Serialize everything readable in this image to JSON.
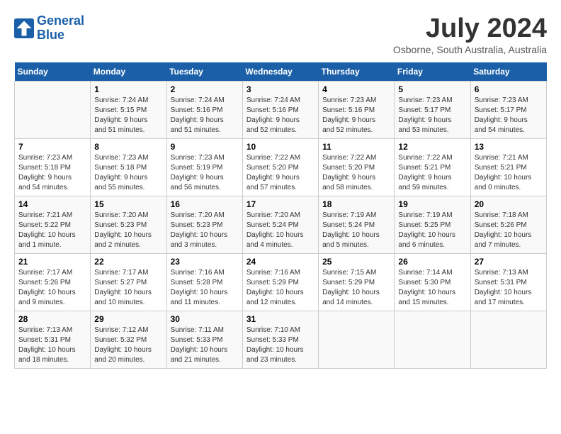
{
  "header": {
    "logo_line1": "General",
    "logo_line2": "Blue",
    "month": "July 2024",
    "location": "Osborne, South Australia, Australia"
  },
  "days_of_week": [
    "Sunday",
    "Monday",
    "Tuesday",
    "Wednesday",
    "Thursday",
    "Friday",
    "Saturday"
  ],
  "weeks": [
    [
      {
        "day": "",
        "info": ""
      },
      {
        "day": "1",
        "info": "Sunrise: 7:24 AM\nSunset: 5:15 PM\nDaylight: 9 hours\nand 51 minutes."
      },
      {
        "day": "2",
        "info": "Sunrise: 7:24 AM\nSunset: 5:16 PM\nDaylight: 9 hours\nand 51 minutes."
      },
      {
        "day": "3",
        "info": "Sunrise: 7:24 AM\nSunset: 5:16 PM\nDaylight: 9 hours\nand 52 minutes."
      },
      {
        "day": "4",
        "info": "Sunrise: 7:23 AM\nSunset: 5:16 PM\nDaylight: 9 hours\nand 52 minutes."
      },
      {
        "day": "5",
        "info": "Sunrise: 7:23 AM\nSunset: 5:17 PM\nDaylight: 9 hours\nand 53 minutes."
      },
      {
        "day": "6",
        "info": "Sunrise: 7:23 AM\nSunset: 5:17 PM\nDaylight: 9 hours\nand 54 minutes."
      }
    ],
    [
      {
        "day": "7",
        "info": "Sunrise: 7:23 AM\nSunset: 5:18 PM\nDaylight: 9 hours\nand 54 minutes."
      },
      {
        "day": "8",
        "info": "Sunrise: 7:23 AM\nSunset: 5:18 PM\nDaylight: 9 hours\nand 55 minutes."
      },
      {
        "day": "9",
        "info": "Sunrise: 7:23 AM\nSunset: 5:19 PM\nDaylight: 9 hours\nand 56 minutes."
      },
      {
        "day": "10",
        "info": "Sunrise: 7:22 AM\nSunset: 5:20 PM\nDaylight: 9 hours\nand 57 minutes."
      },
      {
        "day": "11",
        "info": "Sunrise: 7:22 AM\nSunset: 5:20 PM\nDaylight: 9 hours\nand 58 minutes."
      },
      {
        "day": "12",
        "info": "Sunrise: 7:22 AM\nSunset: 5:21 PM\nDaylight: 9 hours\nand 59 minutes."
      },
      {
        "day": "13",
        "info": "Sunrise: 7:21 AM\nSunset: 5:21 PM\nDaylight: 10 hours\nand 0 minutes."
      }
    ],
    [
      {
        "day": "14",
        "info": "Sunrise: 7:21 AM\nSunset: 5:22 PM\nDaylight: 10 hours\nand 1 minute."
      },
      {
        "day": "15",
        "info": "Sunrise: 7:20 AM\nSunset: 5:23 PM\nDaylight: 10 hours\nand 2 minutes."
      },
      {
        "day": "16",
        "info": "Sunrise: 7:20 AM\nSunset: 5:23 PM\nDaylight: 10 hours\nand 3 minutes."
      },
      {
        "day": "17",
        "info": "Sunrise: 7:20 AM\nSunset: 5:24 PM\nDaylight: 10 hours\nand 4 minutes."
      },
      {
        "day": "18",
        "info": "Sunrise: 7:19 AM\nSunset: 5:24 PM\nDaylight: 10 hours\nand 5 minutes."
      },
      {
        "day": "19",
        "info": "Sunrise: 7:19 AM\nSunset: 5:25 PM\nDaylight: 10 hours\nand 6 minutes."
      },
      {
        "day": "20",
        "info": "Sunrise: 7:18 AM\nSunset: 5:26 PM\nDaylight: 10 hours\nand 7 minutes."
      }
    ],
    [
      {
        "day": "21",
        "info": "Sunrise: 7:17 AM\nSunset: 5:26 PM\nDaylight: 10 hours\nand 9 minutes."
      },
      {
        "day": "22",
        "info": "Sunrise: 7:17 AM\nSunset: 5:27 PM\nDaylight: 10 hours\nand 10 minutes."
      },
      {
        "day": "23",
        "info": "Sunrise: 7:16 AM\nSunset: 5:28 PM\nDaylight: 10 hours\nand 11 minutes."
      },
      {
        "day": "24",
        "info": "Sunrise: 7:16 AM\nSunset: 5:29 PM\nDaylight: 10 hours\nand 12 minutes."
      },
      {
        "day": "25",
        "info": "Sunrise: 7:15 AM\nSunset: 5:29 PM\nDaylight: 10 hours\nand 14 minutes."
      },
      {
        "day": "26",
        "info": "Sunrise: 7:14 AM\nSunset: 5:30 PM\nDaylight: 10 hours\nand 15 minutes."
      },
      {
        "day": "27",
        "info": "Sunrise: 7:13 AM\nSunset: 5:31 PM\nDaylight: 10 hours\nand 17 minutes."
      }
    ],
    [
      {
        "day": "28",
        "info": "Sunrise: 7:13 AM\nSunset: 5:31 PM\nDaylight: 10 hours\nand 18 minutes."
      },
      {
        "day": "29",
        "info": "Sunrise: 7:12 AM\nSunset: 5:32 PM\nDaylight: 10 hours\nand 20 minutes."
      },
      {
        "day": "30",
        "info": "Sunrise: 7:11 AM\nSunset: 5:33 PM\nDaylight: 10 hours\nand 21 minutes."
      },
      {
        "day": "31",
        "info": "Sunrise: 7:10 AM\nSunset: 5:33 PM\nDaylight: 10 hours\nand 23 minutes."
      },
      {
        "day": "",
        "info": ""
      },
      {
        "day": "",
        "info": ""
      },
      {
        "day": "",
        "info": ""
      }
    ]
  ]
}
